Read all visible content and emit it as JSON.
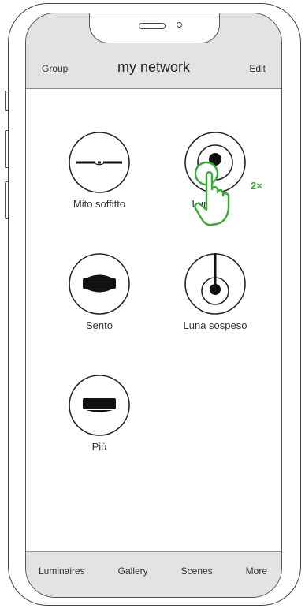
{
  "header": {
    "left_label": "Group",
    "title": "my network",
    "right_label": "Edit"
  },
  "devices": [
    {
      "label": "Mito soffitto",
      "icon": "mito-soffitto-icon"
    },
    {
      "label": "Luna",
      "icon": "luna-icon"
    },
    {
      "label": "Sento",
      "icon": "sento-icon"
    },
    {
      "label": "Luna sospeso",
      "icon": "luna-sospeso-icon"
    },
    {
      "label": "Più",
      "icon": "piu-icon"
    }
  ],
  "gesture": {
    "icon": "double-tap-hand-icon",
    "tap_count": "2×",
    "color": "#3aa935"
  },
  "tabbar": {
    "items": [
      "Luminaires",
      "Gallery",
      "Scenes",
      "More"
    ]
  }
}
